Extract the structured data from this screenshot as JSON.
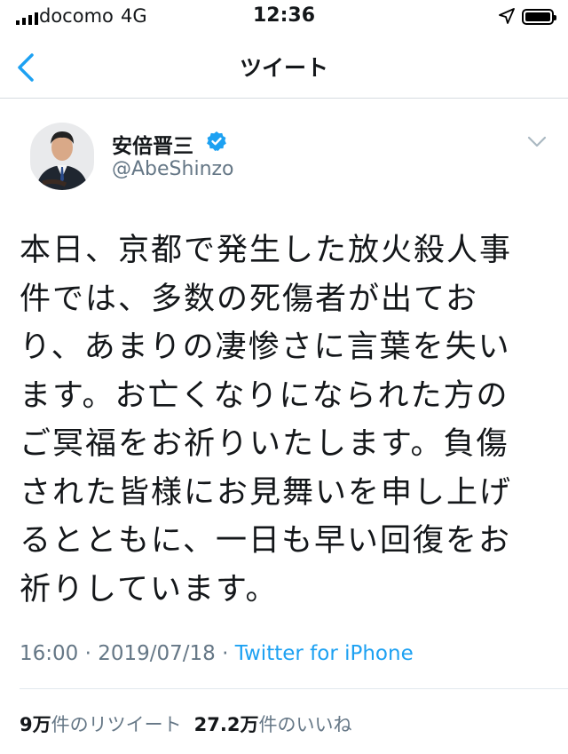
{
  "status_bar": {
    "carrier": "docomo",
    "network": "4G",
    "time": "12:36"
  },
  "nav": {
    "title": "ツイート"
  },
  "tweet": {
    "author_name": "安倍晋三",
    "handle": "@AbeShinzo",
    "text": "本日、京都で発生した放火殺人事\n件では、多数の死傷者が出てお\nり、あまりの凄惨さに言葉を失い\nます。お亡くなりになられた方の\nご冥福をお祈りいたします。負傷\nされた皆様にお見舞いを申し上げ\nるとともに、一日も早い回復をお\n祈りしています。",
    "time": "16:00",
    "separator": "·",
    "date": "2019/07/18",
    "source": "Twitter for iPhone",
    "retweet_count": "9万",
    "retweet_label": "件のリツイート",
    "like_count": "27.2万",
    "like_label": "件のいいね"
  },
  "icons": {
    "back": "chevron-left-icon",
    "verified": "verified-badge-icon",
    "more": "chevron-down-icon",
    "location": "location-arrow-icon",
    "battery": "battery-icon",
    "signal": "signal-bars-icon"
  },
  "colors": {
    "accent": "#1da1f2",
    "secondary_text": "#657786",
    "text": "#14171a"
  }
}
